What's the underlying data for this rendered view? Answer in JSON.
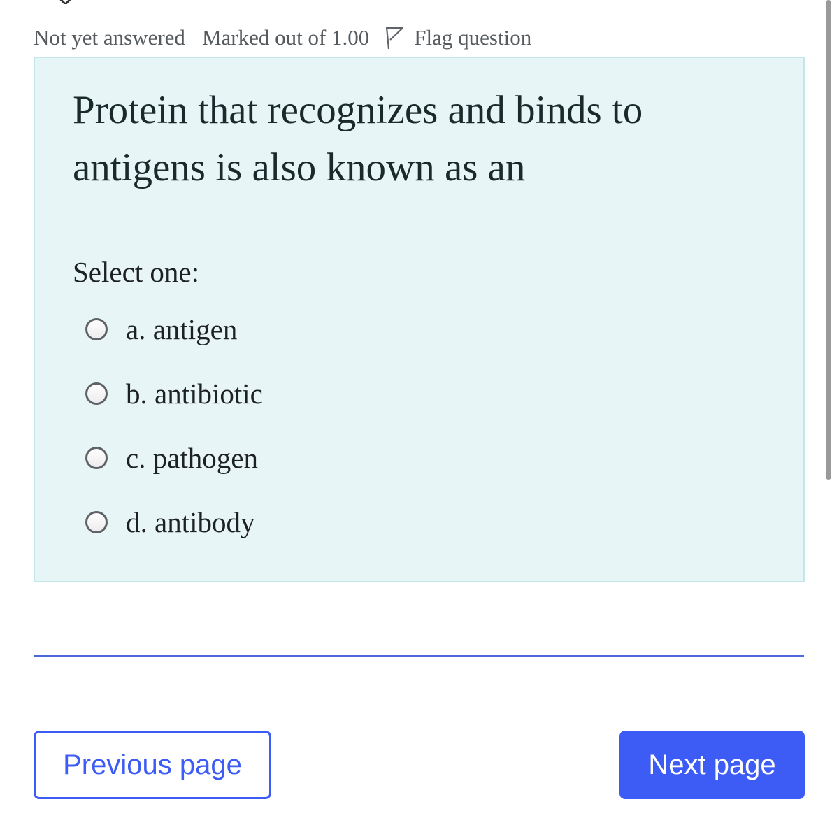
{
  "question_info": {
    "state": "Not yet answered",
    "grade": "Marked out of 1.00",
    "flag_label": "Flag question",
    "flag_icon": "flag-icon"
  },
  "question": {
    "text": "Protein that recognizes and binds to antigens is also known as an",
    "prompt": "Select one:",
    "answers": [
      {
        "label": "a. antigen",
        "selected": false
      },
      {
        "label": "b. antibiotic",
        "selected": false
      },
      {
        "label": "c. pathogen",
        "selected": false
      },
      {
        "label": "d. antibody",
        "selected": false
      }
    ]
  },
  "navigation": {
    "previous_label": "Previous page",
    "next_label": "Next page"
  },
  "colors": {
    "primary": "#3d5cf5",
    "question_background": "#e7f5f6",
    "question_border": "#c3e6ea",
    "divider": "#4a67e0"
  }
}
